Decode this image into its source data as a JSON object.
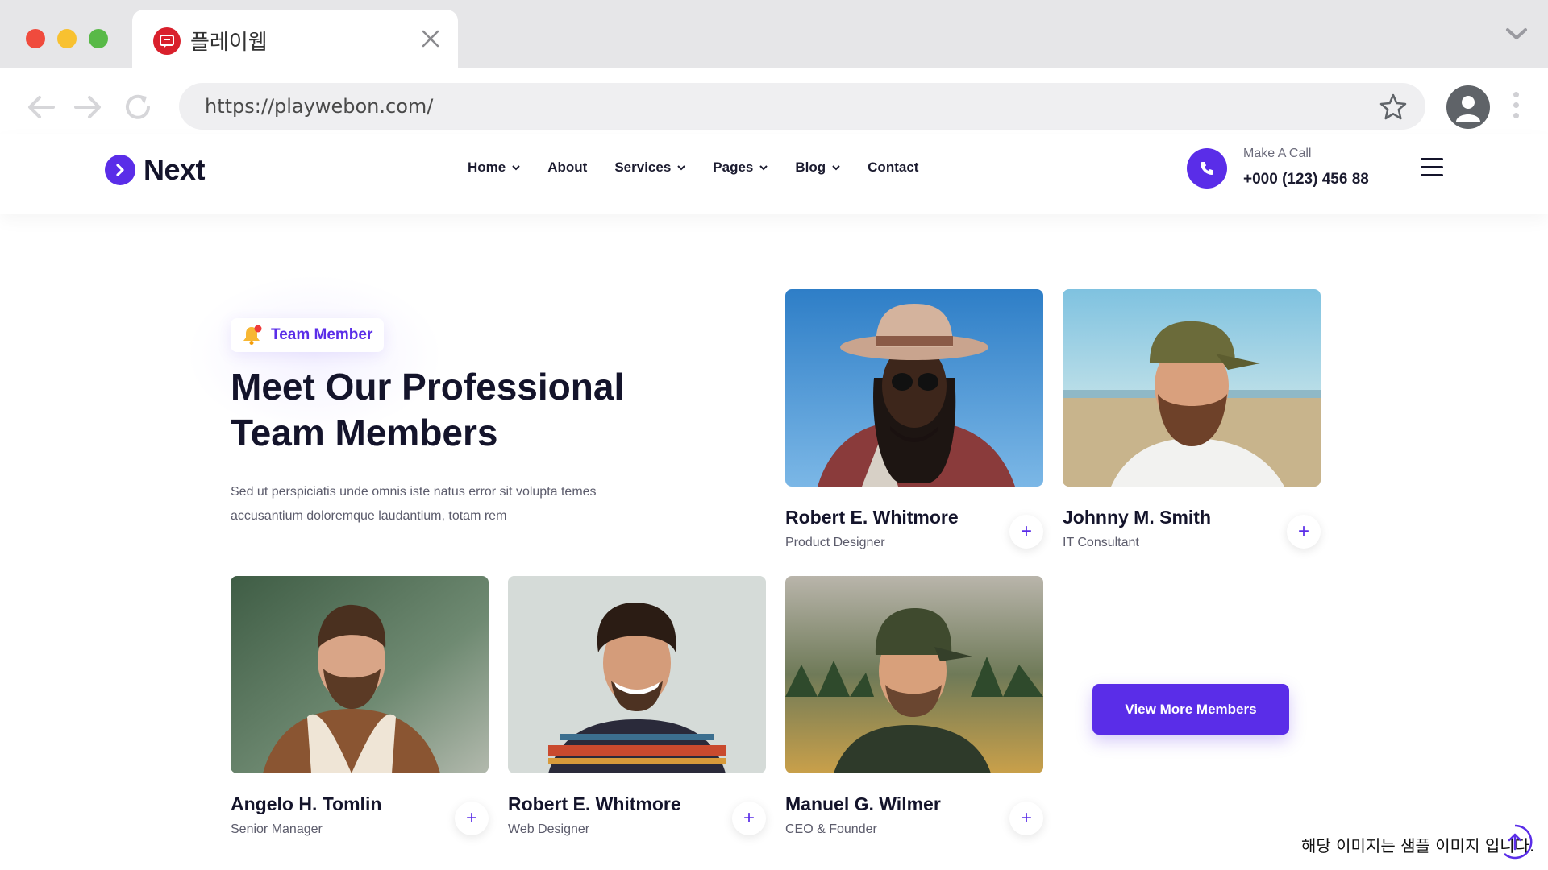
{
  "browser": {
    "tab_title": "플레이웹",
    "url": "https://playwebon.com/"
  },
  "site": {
    "logo_text": "Next",
    "nav": [
      {
        "label": "Home",
        "has_dropdown": true
      },
      {
        "label": "About",
        "has_dropdown": false
      },
      {
        "label": "Services",
        "has_dropdown": true
      },
      {
        "label": "Pages",
        "has_dropdown": true
      },
      {
        "label": "Blog",
        "has_dropdown": true
      },
      {
        "label": "Contact",
        "has_dropdown": false
      }
    ],
    "call_label": "Make A Call",
    "call_number": "+000 (123) 456 88"
  },
  "section": {
    "badge": "Team Member",
    "heading": "Meet Our Professional Team Members",
    "description": "Sed ut perspiciatis unde omnis iste natus error sit volupta temes accusantium doloremque laudantium, totam rem",
    "view_more_label": "View More Members"
  },
  "members": [
    {
      "name": "Robert E. Whitmore",
      "role": "Product Designer"
    },
    {
      "name": "Johnny M. Smith",
      "role": "IT Consultant"
    },
    {
      "name": "Angelo H. Tomlin",
      "role": "Senior Manager"
    },
    {
      "name": "Robert E. Whitmore",
      "role": "Web Designer"
    },
    {
      "name": "Manuel G. Wilmer",
      "role": "CEO & Founder"
    }
  ],
  "plus_symbol": "+",
  "watermark": "해당 이미지는 샘플 이미지 입니다.",
  "colors": {
    "accent": "#5a2de8",
    "heading": "#14142b",
    "body_text": "#5c5c6c"
  }
}
